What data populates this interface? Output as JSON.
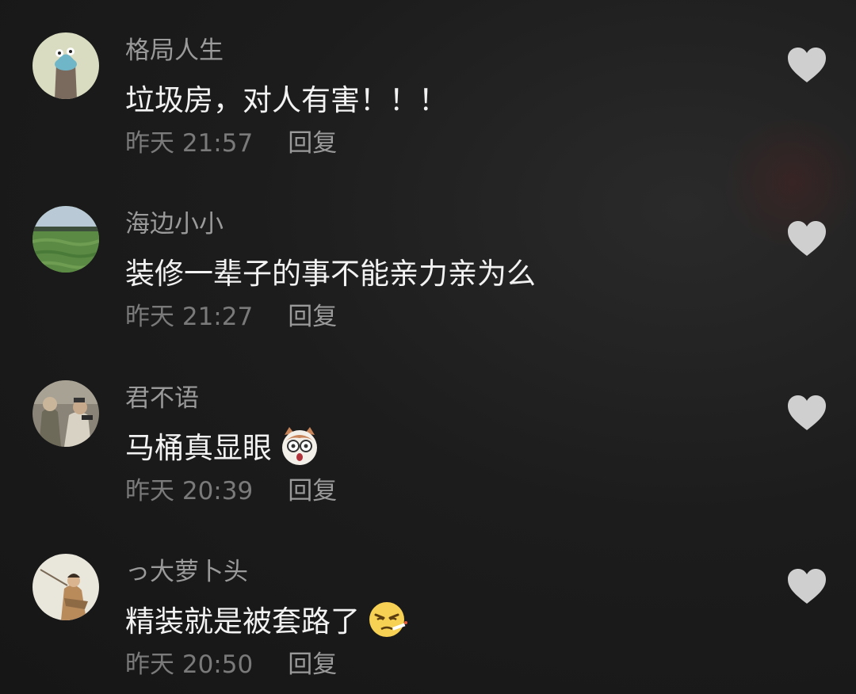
{
  "comments": [
    {
      "username": "格局人生",
      "text": "垃圾房，对人有害！！！",
      "time": "昨天 21:57",
      "reply": "回复",
      "avatar": "cartoon-avatar-icon",
      "emoji": null
    },
    {
      "username": "海边小小",
      "text": "装修一辈子的事不能亲力亲为么",
      "time": "昨天 21:27",
      "reply": "回复",
      "avatar": "field-landscape-avatar-icon",
      "emoji": null
    },
    {
      "username": "君不语",
      "text": "马桶真显眼",
      "time": "昨天 20:39",
      "reply": "回复",
      "avatar": "movie-still-avatar-icon",
      "emoji": "shocked-face-emoji"
    },
    {
      "username": "っ大萝卜头",
      "text": "精装就是被套路了",
      "time": "昨天 20:50",
      "reply": "回复",
      "avatar": "ancient-figure-avatar-icon",
      "emoji": "annoyed-smoking-face-emoji"
    }
  ],
  "colors": {
    "background": "#1c1c1c",
    "username": "#9a9a9a",
    "text": "#f2f2f2",
    "meta": "#7a7a7a",
    "like_icon": "#cfcfcf"
  }
}
